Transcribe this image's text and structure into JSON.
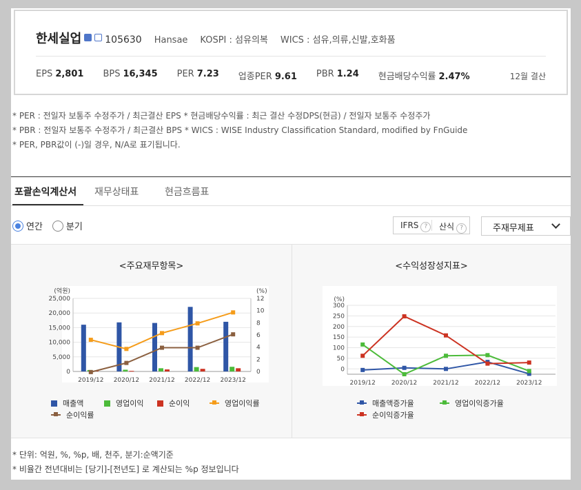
{
  "header": {
    "company_name": "한세실업",
    "code": "105630",
    "english_name": "Hansae",
    "market": "KOSPI : 섬유의복",
    "wics": "WICS : 섬유,의류,신발,호화품",
    "metrics": [
      {
        "label": "EPS",
        "value": "2,801"
      },
      {
        "label": "BPS",
        "value": "16,345"
      },
      {
        "label": "PER",
        "value": "7.23"
      },
      {
        "label": "업종PER",
        "value": "9.61"
      },
      {
        "label": "PBR",
        "value": "1.24"
      },
      {
        "label": "현금배당수익률",
        "value": "2.47%"
      }
    ],
    "settlement": "12월 결산"
  },
  "notes": [
    "* PER : 전일자 보통주 수정주가 / 최근결산 EPS * 현금배당수익률 : 최근 결산 수정DPS(현금) / 전일자 보통주 수정주가",
    "* PBR : 전일자 보통주 수정주가 / 최근결산 BPS * WICS : WISE Industry Classification Standard, modified by FnGuide",
    "* PER, PBR값이 (-)일 경우, N/A로 표기됩니다."
  ],
  "tabs": [
    {
      "label": "포괄손익계산서",
      "active": true
    },
    {
      "label": "재무상태표",
      "active": false
    },
    {
      "label": "현금흐름표",
      "active": false
    }
  ],
  "period": {
    "options": [
      "연간",
      "분기"
    ],
    "selected": "연간"
  },
  "controls": {
    "ifrs": "IFRS",
    "calc": "산식",
    "help": "?",
    "select_value": "주재무제표"
  },
  "chart_data": [
    {
      "type": "bar",
      "title": "<주요재무항목>",
      "categories": [
        "2019/12",
        "2020/12",
        "2021/12",
        "2022/12",
        "2023/12"
      ],
      "y_left_label": "(억원)",
      "y_right_label": "(%)",
      "ylim_left": [
        0,
        25000
      ],
      "ylim_right": [
        0,
        12
      ],
      "y_left_ticks": [
        "0",
        "5,000",
        "10,000",
        "15,000",
        "20,000",
        "25,000"
      ],
      "y_right_ticks": [
        "0",
        "2",
        "4",
        "6",
        "8",
        "10",
        "12"
      ],
      "series": [
        {
          "name": "매출액",
          "kind": "bar",
          "axis": "left",
          "color": "#2f56a6",
          "values": [
            16000,
            16800,
            16600,
            22100,
            17000
          ]
        },
        {
          "name": "영업이익",
          "kind": "bar",
          "axis": "left",
          "color": "#4cbb3a",
          "values": [
            500,
            600,
            1100,
            1500,
            1600
          ]
        },
        {
          "name": "순이익",
          "kind": "bar",
          "axis": "left",
          "color": "#cc3322",
          "values": [
            300,
            200,
            700,
            900,
            1100
          ]
        },
        {
          "name": "영업이익률",
          "kind": "line",
          "axis": "right",
          "color": "#f59c1a",
          "values": [
            5.2,
            3.7,
            6.3,
            7.9,
            9.7
          ]
        },
        {
          "name": "순이익률",
          "kind": "line",
          "axis": "right",
          "color": "#8b6040",
          "values": [
            -0.1,
            1.4,
            3.9,
            3.9,
            6.1
          ]
        }
      ],
      "legend": "bottom"
    },
    {
      "type": "line",
      "title": "<수익성장성지표>",
      "categories": [
        "2019/12",
        "2020/12",
        "2021/12",
        "2022/12",
        "2023/12"
      ],
      "y_label": "(%)",
      "ylim": [
        -25,
        300
      ],
      "y_ticks": [
        "0",
        "50",
        "100",
        "150",
        "200",
        "250",
        "300"
      ],
      "series": [
        {
          "name": "매출액증가율",
          "color": "#2f56a6",
          "values": [
            -5,
            5,
            0,
            33,
            -23
          ]
        },
        {
          "name": "영업이익증가율",
          "color": "#4cbb3a",
          "values": [
            115,
            -25,
            62,
            65,
            -10
          ]
        },
        {
          "name": "순이익증가율",
          "color": "#cc3322",
          "values": [
            62,
            248,
            158,
            25,
            30
          ]
        }
      ],
      "legend": "bottom"
    }
  ],
  "bottom_notes": [
    "* 단위: 억원, %, %p, 배, 천주, 분기:순액기준",
    "* 비율간 전년대비는 [당기]-[전년도] 로 계산되는 %p 정보입니다"
  ]
}
